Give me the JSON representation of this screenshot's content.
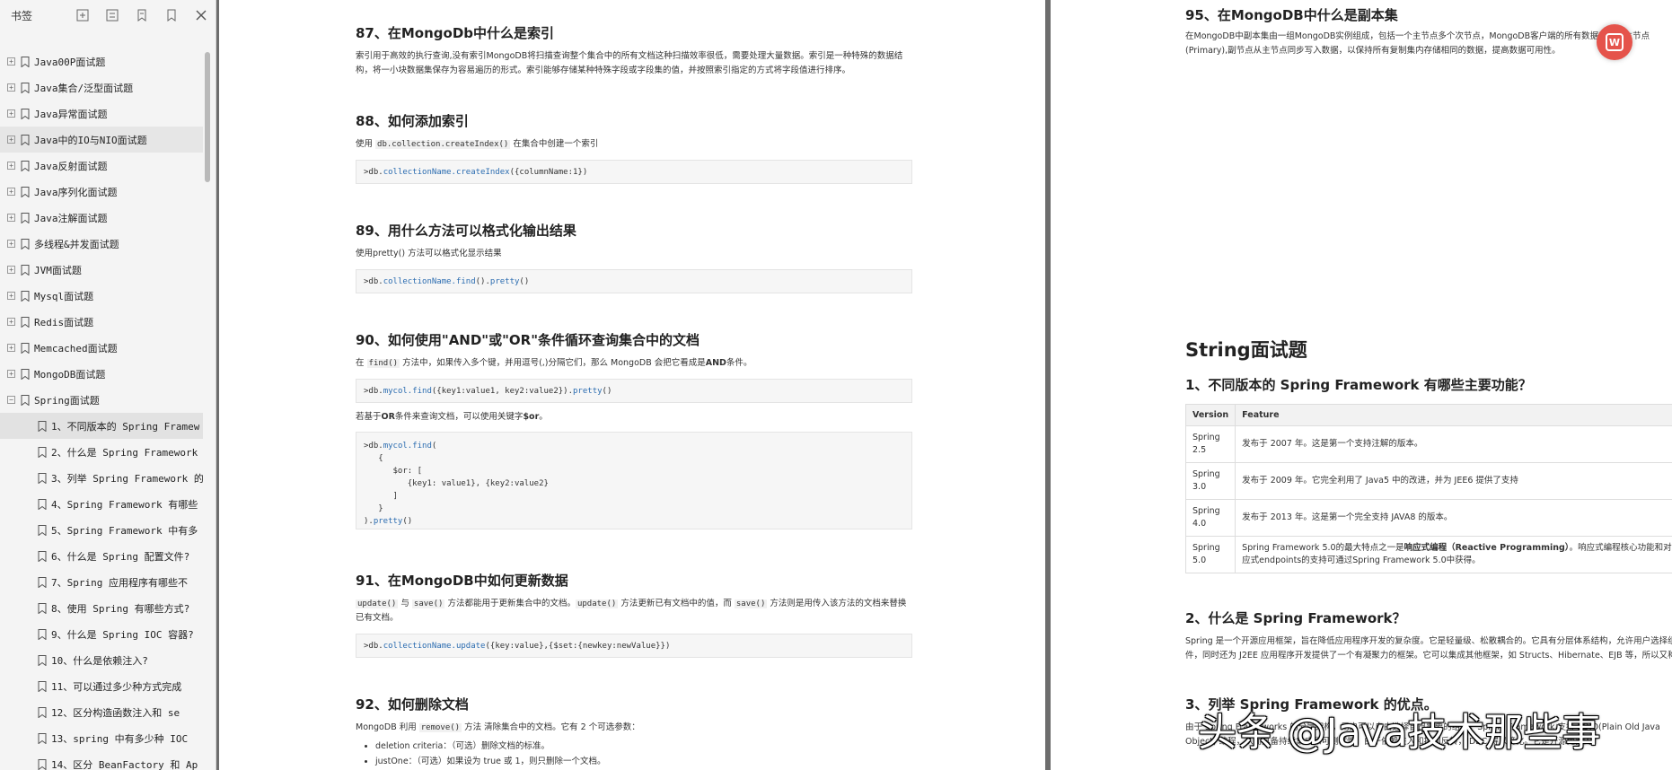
{
  "sidebar": {
    "title": "书签",
    "tools": [
      {
        "icon": "expand-all-icon"
      },
      {
        "icon": "collapse-all-icon"
      },
      {
        "icon": "add-bookmark-icon"
      },
      {
        "icon": "bookmark-icon"
      },
      {
        "icon": "close-icon"
      }
    ],
    "items": [
      {
        "label": "Java00P面试题",
        "level": 1,
        "expand": "+"
      },
      {
        "label": "Java集合/泛型面试题",
        "level": 1,
        "expand": "+"
      },
      {
        "label": "Java异常面试题",
        "level": 1,
        "expand": "+"
      },
      {
        "label": "Java中的IO与NIO面试题",
        "level": 1,
        "expand": "+"
      },
      {
        "label": "Java反射面试题",
        "level": 1,
        "expand": "+"
      },
      {
        "label": "Java序列化面试题",
        "level": 1,
        "expand": "+"
      },
      {
        "label": "Java注解面试题",
        "level": 1,
        "expand": "+"
      },
      {
        "label": "多线程&并发面试题",
        "level": 1,
        "expand": "+"
      },
      {
        "label": "JVM面试题",
        "level": 1,
        "expand": "+"
      },
      {
        "label": "Mysql面试题",
        "level": 1,
        "expand": "+"
      },
      {
        "label": "Redis面试题",
        "level": 1,
        "expand": "+"
      },
      {
        "label": "Memcached面试题",
        "level": 1,
        "expand": "+"
      },
      {
        "label": "MongoDB面试题",
        "level": 1,
        "expand": "+"
      },
      {
        "label": "Spring面试题",
        "level": 1,
        "expand": "−"
      },
      {
        "label": "1、不同版本的 Spring Framew",
        "level": 2
      },
      {
        "label": "2、什么是 Spring Framework",
        "level": 2
      },
      {
        "label": "3、列举 Spring Framework 的",
        "level": 2
      },
      {
        "label": "4、Spring Framework 有哪些",
        "level": 2
      },
      {
        "label": "5、Spring Framework 中有多",
        "level": 2
      },
      {
        "label": "6、什么是 Spring 配置文件?",
        "level": 2
      },
      {
        "label": "7、Spring 应用程序有哪些不",
        "level": 2
      },
      {
        "label": "8、使用 Spring 有哪些方式?",
        "level": 2
      },
      {
        "label": "9、什么是 Spring IOC 容器?",
        "level": 2
      },
      {
        "label": "10、什么是依赖注入?",
        "level": 2
      },
      {
        "label": "11、可以通过多少种方式完成",
        "level": 2
      },
      {
        "label": "12、区分构造函数注入和 se",
        "level": 2
      },
      {
        "label": "13、spring 中有多少种 IOC",
        "level": 2
      },
      {
        "label": "14、区分 BeanFactory 和 Ap",
        "level": 2
      }
    ]
  },
  "page_left": {
    "s87": {
      "title": "87、在MongoDb中什么是索引",
      "text": "索引用于高效的执行查询,没有索引MongoDB将扫描查询整个集合中的所有文档这种扫描效率很低，需要处理大量数据。索引是一种特殊的数据结构，将一小块数据集保存为容易遍历的形式。索引能够存储某种特殊字段或字段集的值，并按照索引指定的方式将字段值进行排序。"
    },
    "s88": {
      "title": "88、如何添加索引",
      "text_a": "使用 ",
      "text_code": "db.collection.createIndex()",
      "text_b": " 在集合中创建一个索引",
      "code_a": ">db.",
      "code_kw": "collectionName.createIndex",
      "code_b": "({columnName:1})"
    },
    "s89": {
      "title": "89、用什么方法可以格式化输出结果",
      "text": "使用pretty() 方法可以格式化显示结果",
      "code_a": ">db.",
      "code_kw": "collectionName.find",
      "code_b": "().",
      "code_kw2": "pretty",
      "code_c": "()"
    },
    "s90": {
      "title": "90、如何使用\"AND\"或\"OR\"条件循环查询集合中的文档",
      "text_a": "在 ",
      "text_code": "find()",
      "text_b": " 方法中，如果传入多个键，并用逗号(,)分隔它们，那么 MongoDB 会把它看成是",
      "text_bold": "AND",
      "text_c": "条件。",
      "code1_a": ">db.",
      "code1_kw": "mycol.find",
      "code1_b": "({key1:value1, key2:value2}).",
      "code1_kw2": "pretty",
      "code1_c": "()",
      "text2_a": "若基于",
      "text2_bold1": "OR",
      "text2_b": "条件来查询文档，可以使用关键字",
      "text2_bold2": "$or",
      "text2_c": "。",
      "code2_l1a": ">db.",
      "code2_l1kw": "mycol.find",
      "code2_l1b": "(",
      "code2_l2": "   {",
      "code2_l3": "      $or: [",
      "code2_l4": "         {key1: value1}, {key2:value2}",
      "code2_l5": "      ]",
      "code2_l6": "   }",
      "code2_l7a": ").",
      "code2_l7kw": "pretty",
      "code2_l7b": "()"
    },
    "s91": {
      "title": "91、在MongoDB中如何更新数据",
      "text_c1": "update()",
      "text_a": " 与 ",
      "text_c2": "save()",
      "text_b": " 方法都能用于更新集合中的文档。",
      "text_c3": "update()",
      "text_c": " 方法更新已有文档中的值，而 ",
      "text_c4": "save()",
      "text_d": " 方法则是用传入该方法的文档来替换已有文档。",
      "code_a": ">db.",
      "code_kw": "collectionName.update",
      "code_b": "({key:value},{$set:{newkey:newValue}})"
    },
    "s92": {
      "title": "92、如何删除文档",
      "text_a": "MongoDB 利用 ",
      "text_code": "remove()",
      "text_b": " 方法 清除集合中的文档。它有 2 个可选参数：",
      "bullets": [
        "deletion criteria：（可选）删除文档的标准。",
        "justOne：（可选）如果设为 true 或 1，则只删除一个文档。"
      ]
    }
  },
  "page_right": {
    "s95": {
      "title": "95、在MongoDB中什么是副本集",
      "text": "在MongoDB中副本集由一组MongoDB实例组成，包括一个主节点多个次节点，MongoDB客户端的所有数据都写入主节点(Primary),副节点从主节点同步写入数据，以保持所有复制集内存储相同的数据，提高数据可用性。"
    },
    "chapter": "String面试题",
    "q1": {
      "title": "1、不同版本的 Spring Framework 有哪些主要功能？",
      "headers": [
        "Version",
        "Feature"
      ],
      "rows": [
        {
          "v": "Spring 2.5",
          "f": "发布于 2007 年。这是第一个支持注解的版本。"
        },
        {
          "v": "Spring 3.0",
          "f": "发布于 2009 年。它完全利用了 Java5 中的改进，并为 JEE6 提供了支持"
        },
        {
          "v": "Spring 4.0",
          "f": "发布于 2013 年。这是第一个完全支持 JAVA8 的版本。"
        },
        {
          "v": "Spring 5.0",
          "f_a": "Spring Framework 5.0的最大特点之一是",
          "f_bold": "响应式编程（Reactive Programming）",
          "f_b": "。响应式编程核心功能和对响应式endpoints的支持可通过Spring Framework 5.0中获得。"
        }
      ]
    },
    "q2": {
      "title": "2、什么是 Spring Framework？",
      "text": "Spring 是一个开源应用框架，旨在降低应用程序开发的复杂度。它是轻量级、松散耦合的。它具有分层体系结构，允许用户选择组件，同时还为 J2EE 应用程序开发提供了一个有凝聚力的框架。它可以集成其他框架，如 Structs、Hibernate、EJB 等，所以又称为框架的框架。"
    },
    "q3": {
      "title": "3、列举 Spring Framework 的优点。",
      "text": "由于 Spring Frameworks 的分层架构，用户可以自由选择自己需要的组件。Spring Framework 支持 POJO(Plain Old Java Object) 编程，从而具备持续集成和可测试性。由于依赖注入和控制反转，JDBC 得以简化。它是开源免费的。"
    }
  },
  "overlay": {
    "fab_icon": "wps-icon",
    "fab_glyph": "W",
    "watermark": "头条 @Java技术那些事"
  }
}
